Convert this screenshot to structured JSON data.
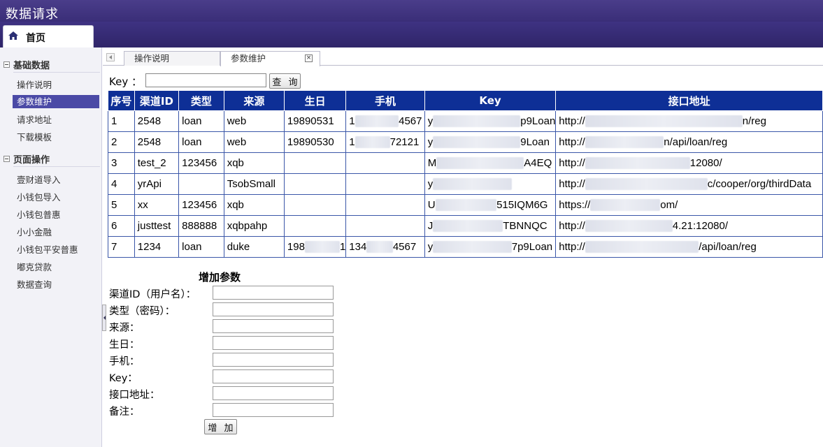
{
  "app": {
    "title": "数据请求",
    "home_tab": "首页"
  },
  "sidebar": {
    "sections": [
      {
        "title": "基础数据",
        "items": [
          "操作说明",
          "参数维护",
          "请求地址",
          "下载模板"
        ]
      },
      {
        "title": "页面操作",
        "items": [
          "壹财道导入",
          "小钱包导入",
          "小钱包普惠",
          "小小金融",
          "小钱包平安普惠",
          "嘟克贷款",
          "数据查询"
        ]
      }
    ],
    "active_item": "参数维护"
  },
  "tabs": [
    {
      "label": "操作说明",
      "selected": false
    },
    {
      "label": "参数维护",
      "selected": true,
      "close_glyph": "×"
    }
  ],
  "search": {
    "label": "Key ：",
    "value": "",
    "button": "查 询"
  },
  "table": {
    "headers": [
      "序号",
      "渠道ID",
      "类型",
      "来源",
      "生日",
      "手机",
      "Key",
      "接口地址"
    ],
    "rows": [
      [
        "1",
        "2548",
        "loan",
        "web",
        "19890531",
        "1█████4567",
        "y██████████p9Loan",
        "http://██████████████████n/reg"
      ],
      [
        "2",
        "2548",
        "loan",
        "web",
        "19890530",
        "1████72121",
        "y██████████9Loan",
        "http://█████████n/api/loan/reg"
      ],
      [
        "3",
        "test_2",
        "123456",
        "xqb",
        "",
        "",
        "M██████████A4EQ",
        "http://████████████12080/"
      ],
      [
        "4",
        "yrApi",
        "",
        "TsobSmall",
        "",
        "",
        "y█████████",
        "http://██████████████c/cooper/org/thirdData"
      ],
      [
        "5",
        "xx",
        "123456",
        "xqb",
        "",
        "",
        "U███████515IQM6G",
        "https://████████om/"
      ],
      [
        "6",
        "justtest",
        "888888",
        "xqbpahp",
        "",
        "",
        "J████████TBNNQC",
        "http://██████████4.21:12080/"
      ],
      [
        "7",
        "1234",
        "loan",
        "duke",
        "198████1",
        "134███4567",
        "y█████████7p9Loan",
        "http://█████████████/api/loan/reg"
      ]
    ]
  },
  "add_form": {
    "title": "增加参数",
    "fields": [
      "渠道ID（用户名）：",
      "类型（密码）：",
      "来源：",
      "生日：",
      "手机：",
      "Key：",
      "接口地址：",
      "备注："
    ],
    "button": "增 加"
  },
  "colors": {
    "header_bg": "#3a2e78",
    "table_header": "#0e2f96",
    "active_nav": "#4b4aa6"
  }
}
